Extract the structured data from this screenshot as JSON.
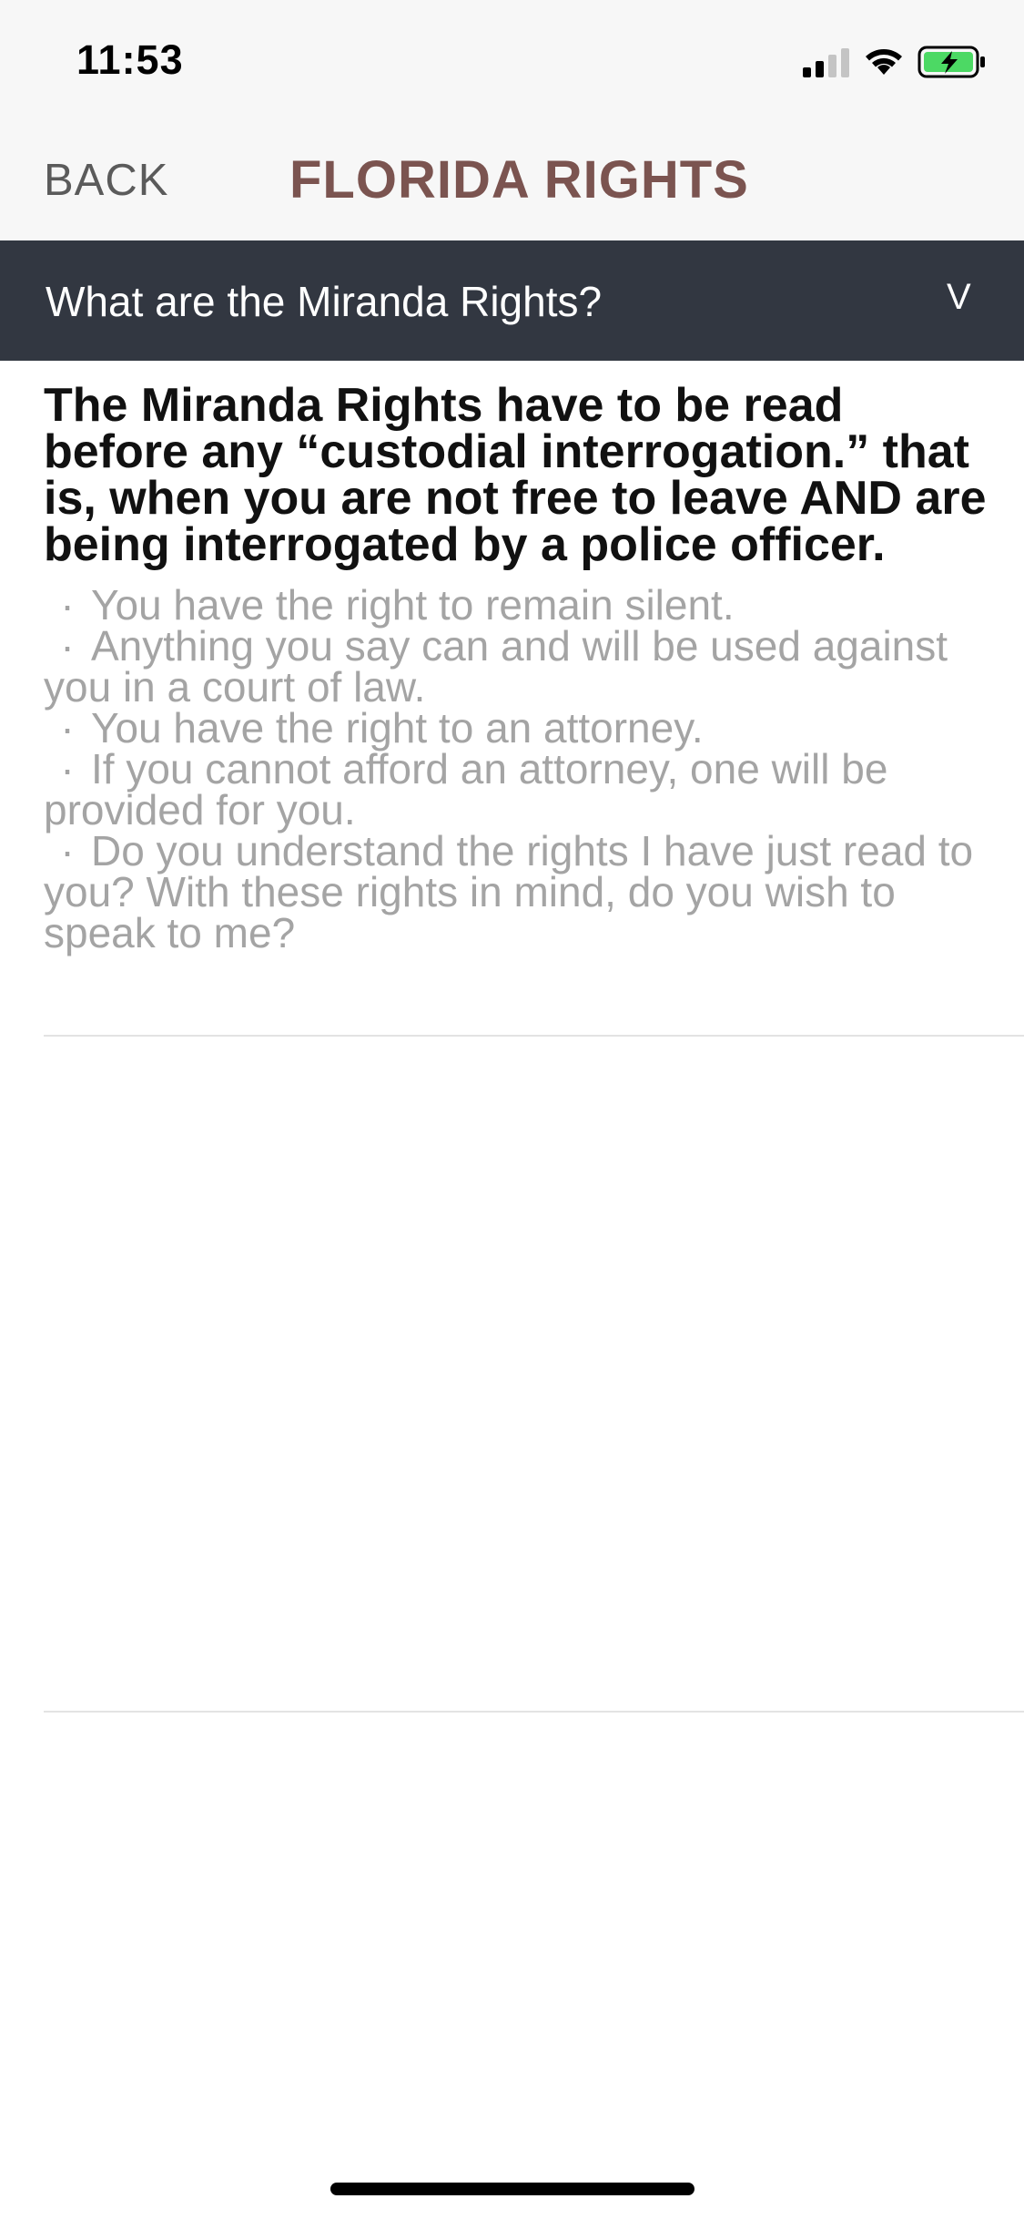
{
  "status_bar": {
    "time": "11:53",
    "signal_icon": "cellular-signal-icon",
    "wifi_icon": "wifi-icon",
    "battery_icon": "battery-charging-icon",
    "battery_color": "#4cd964"
  },
  "nav": {
    "back_label": "BACK",
    "title": "FLORIDA RIGHTS",
    "title_color": "#7b5450"
  },
  "accordion": {
    "title": "What are the Miranda Rights?",
    "chevron": "V",
    "header_color": "#323741"
  },
  "content": {
    "lead": "The Miranda Rights have to be read before any “custodial interrogation.” that is, when you are not free to leave AND are being interrogated by a police officer.",
    "bullet_symbol": "·",
    "rights": [
      "You have the right to remain silent.",
      "Anything you say can and will be used against you in a court of law.",
      "You have the right to an attorney.",
      "If you cannot afford an attorney, one will be provided for you.",
      "Do you understand the rights I have just read to you? With these rights in mind, do you wish to speak to me?"
    ]
  }
}
